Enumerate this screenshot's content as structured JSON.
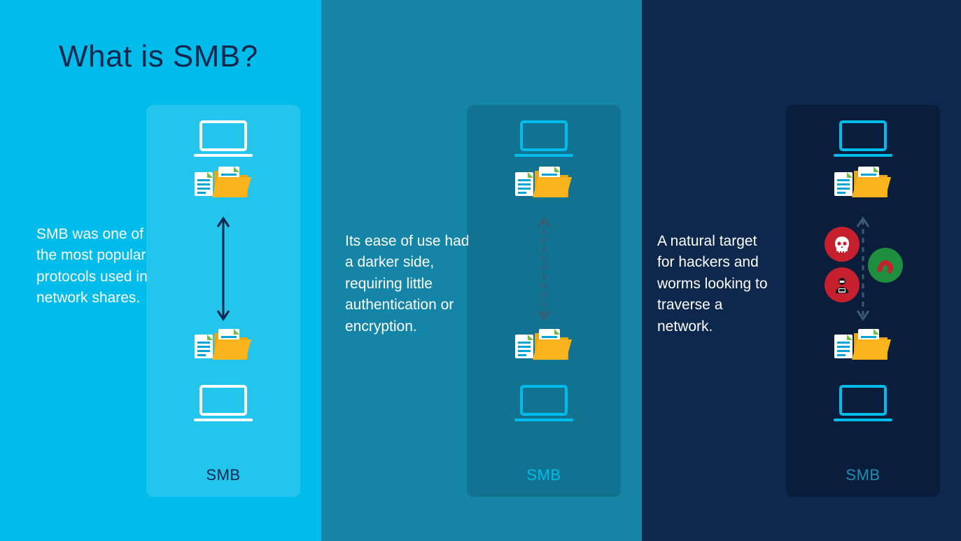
{
  "title": "What is SMB?",
  "panels": [
    {
      "desc": "SMB was one of the most popular protocols used in network shares.",
      "card_label": "SMB"
    },
    {
      "desc": "Its ease of use had a darker side, requiring little authentication or encryption.",
      "card_label": "SMB"
    },
    {
      "desc": "A natural target for hackers and worms looking to traverse a network.",
      "card_label": "SMB"
    }
  ],
  "colors": {
    "panel1_bg": "#00bceb",
    "panel2_bg": "#1485a6",
    "panel3_bg": "#0d274d",
    "accent_cyan": "#00bceb",
    "dark_navy": "#0d274d",
    "threat_red": "#c6202e",
    "threat_green": "#1e8f3e"
  },
  "icons": [
    "laptop-icon",
    "folder-files-icon",
    "double-arrow-icon",
    "double-arrow-dashed-icon",
    "skull-icon",
    "hacker-icon",
    "worm-icon"
  ]
}
